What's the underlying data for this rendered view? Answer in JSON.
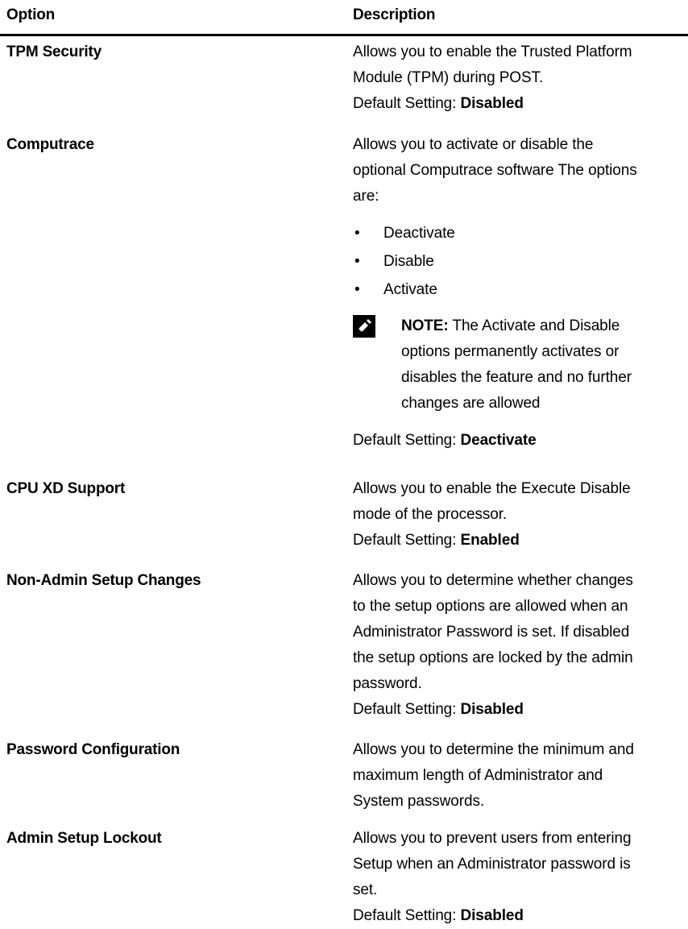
{
  "table": {
    "headers": {
      "option": "Option",
      "description": "Description"
    },
    "rows": [
      {
        "option": "TPM Security",
        "desc_lines": [
          "Allows you to enable the Trusted Platform",
          "Module (TPM) during POST."
        ],
        "default_prefix": "Default Setting: ",
        "default_value": "Disabled"
      },
      {
        "option": "Computrace",
        "desc_lines": [
          "Allows you to activate or disable the",
          "optional Computrace software The options",
          "are:"
        ],
        "bullets": [
          "Deactivate",
          "Disable",
          "Activate"
        ],
        "bullet_glyph": "•",
        "note": {
          "label": "NOTE:",
          "lines": [
            " The Activate and Disable",
            "options permanently activates or",
            "disables the feature and no further",
            "changes are allowed"
          ],
          "icon": "pencil-note-icon"
        },
        "default_prefix": "Default Setting: ",
        "default_value": "Deactivate"
      },
      {
        "option": "CPU XD Support",
        "desc_lines": [
          "Allows you to enable the Execute Disable",
          "mode of the processor."
        ],
        "default_prefix": "Default Setting: ",
        "default_value": "Enabled"
      },
      {
        "option": "Non-Admin Setup Changes",
        "desc_lines": [
          "Allows you to determine whether changes",
          "to the setup options are allowed when an",
          "Administrator Password is set. If disabled",
          "the setup options are locked by the admin",
          "password."
        ],
        "default_prefix": "Default Setting: ",
        "default_value": "Disabled"
      },
      {
        "option": "Password Configuration",
        "desc_lines": [
          "Allows you to determine the minimum and",
          "maximum length of Administrator and",
          "System passwords."
        ]
      },
      {
        "option": "Admin Setup Lockout",
        "desc_lines": [
          "Allows you to prevent users from entering",
          "Setup when an Administrator password is",
          "set."
        ],
        "default_prefix": "Default Setting: ",
        "default_value": "Disabled"
      }
    ]
  }
}
